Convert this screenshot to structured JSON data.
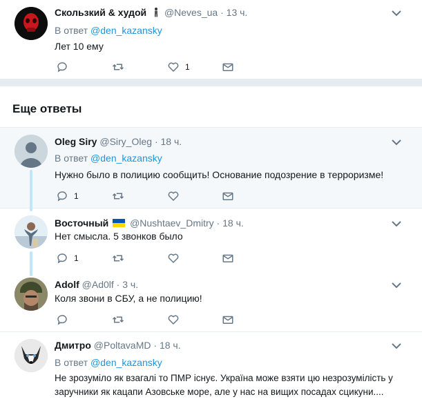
{
  "tweets": [
    {
      "name": "Скользкий & худой",
      "handle": "@Neves_ua",
      "time": "13 ч.",
      "reply_prefix": "В ответ",
      "reply_to": "@den_kazansky",
      "text": "Лет 10 ему",
      "likes": "1"
    },
    {
      "name": "Oleg Siry",
      "handle": "@Siry_Oleg",
      "time": "18 ч.",
      "reply_prefix": "В ответ",
      "reply_to": "@den_kazansky",
      "text": "Нужно было в полицию сообщить! Основание подозрение в терроризме!",
      "replies": "1"
    },
    {
      "name": "Восточный",
      "handle": "@Nushtaev_Dmitry",
      "time": "18 ч.",
      "text": "Нет смысла. 5 звонков было",
      "replies": "1"
    },
    {
      "name": "Adolf",
      "handle": "@Ad0lf",
      "time": "3 ч.",
      "text": "Коля звони в СБУ, а не полицию!"
    },
    {
      "name": "Дмитро",
      "handle": "@PoltavaMD",
      "time": "18 ч.",
      "reply_prefix": "В ответ",
      "reply_to": "@den_kazansky",
      "text": "Не зрозуміло як взагалі то ПМР існує. Україна може взяти цю незрозумілість у заручники як кацапи Азовське море, але у  нас на вищих посадах сцикуни...."
    }
  ],
  "section": {
    "title": "Еще ответы"
  },
  "colors": {
    "accent": "#1b95e0",
    "muted": "#657786",
    "highlight_bg": "#f5f8fa",
    "thread": "#c4e5f9"
  },
  "icons": [
    "reply-icon",
    "retweet-icon",
    "like-icon",
    "dm-icon",
    "chevron-down-icon"
  ]
}
